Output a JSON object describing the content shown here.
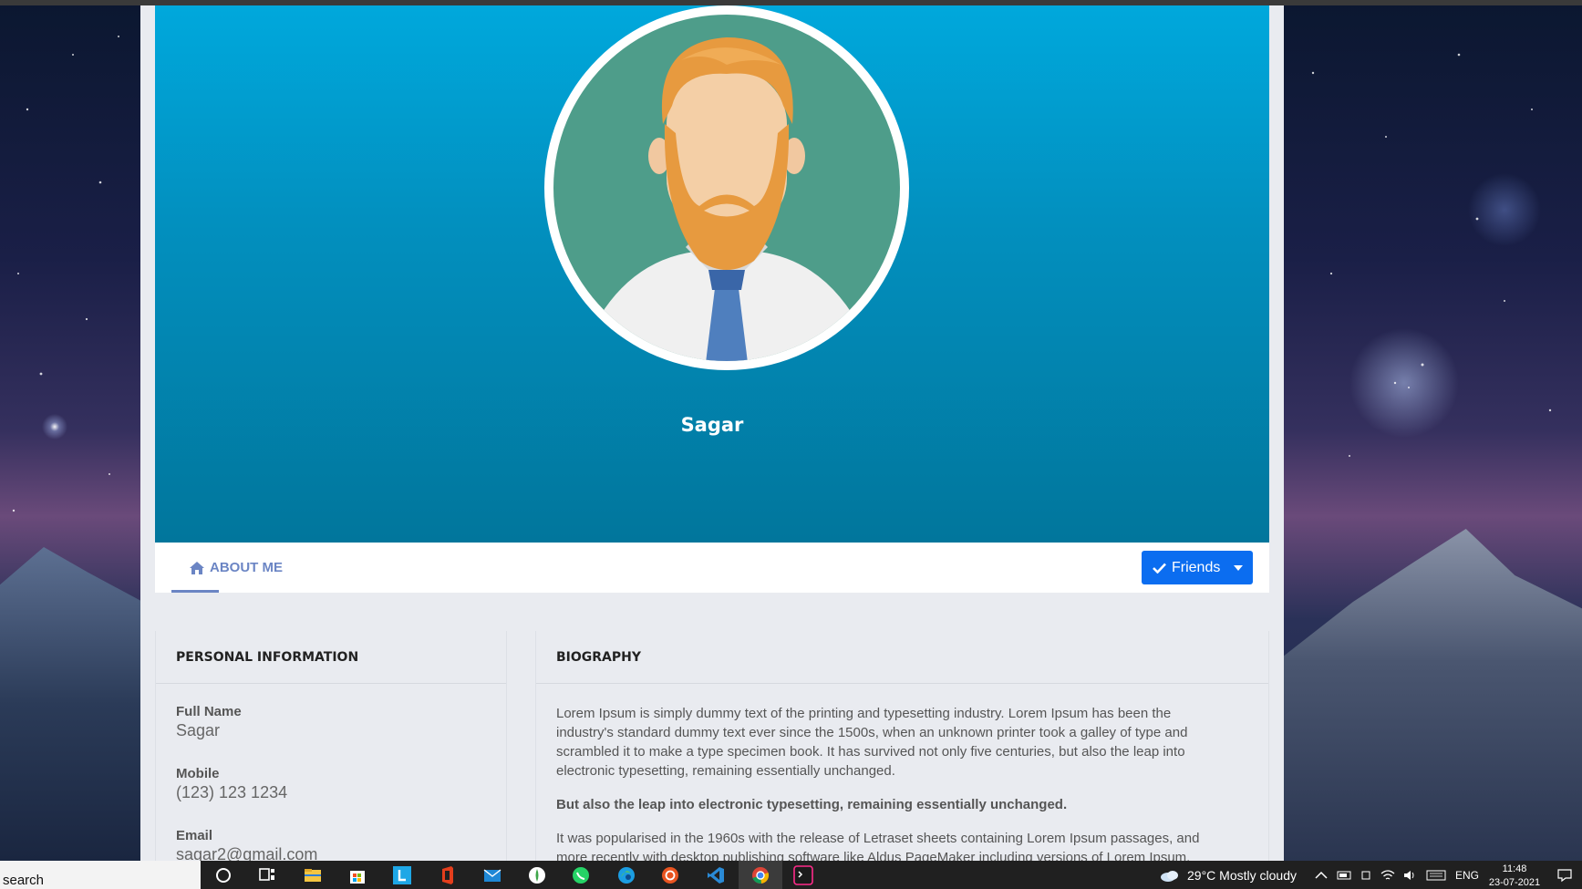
{
  "profile": {
    "name": "Sagar"
  },
  "tabs": {
    "about_label": "ABOUT ME"
  },
  "actions": {
    "friends_label": "Friends"
  },
  "personal": {
    "header": "PERSONAL INFORMATION",
    "fields": [
      {
        "label": "Full Name",
        "value": "Sagar"
      },
      {
        "label": "Mobile",
        "value": "(123) 123 1234"
      },
      {
        "label": "Email",
        "value": "sagar2@gmail.com"
      }
    ]
  },
  "biography": {
    "header": "BIOGRAPHY",
    "paragraphs": [
      "Lorem Ipsum is simply dummy text of the printing and typesetting industry. Lorem Ipsum has been the industry's standard dummy text ever since the 1500s, when an unknown printer took a galley of type and scrambled it to make a type specimen book. It has survived not only five centuries, but also the leap into electronic typesetting, remaining essentially unchanged.",
      "But also the leap into electronic typesetting, remaining essentially unchanged.",
      "It was popularised in the 1960s with the release of Letraset sheets containing Lorem Ipsum passages, and more recently with desktop publishing software like Aldus PageMaker including versions of Lorem Ipsum."
    ]
  },
  "taskbar": {
    "search_text": "search",
    "weather": "29°C  Mostly cloudy",
    "language": "ENG",
    "time": "11:48",
    "date": "23-07-2021",
    "icons": [
      "cortana-icon",
      "task-view-icon",
      "file-explorer-icon",
      "store-icon",
      "l-app-icon",
      "office-icon",
      "mail-icon",
      "node-icon",
      "whatsapp-icon",
      "edge-icon",
      "ubuntu-icon",
      "vscode-icon",
      "chrome-icon",
      "terminal-icon"
    ]
  },
  "colors": {
    "cover_top": "#00a8dc",
    "cover_bottom": "#01769c",
    "accent": "#6b85c4",
    "button": "#0b6df0"
  }
}
